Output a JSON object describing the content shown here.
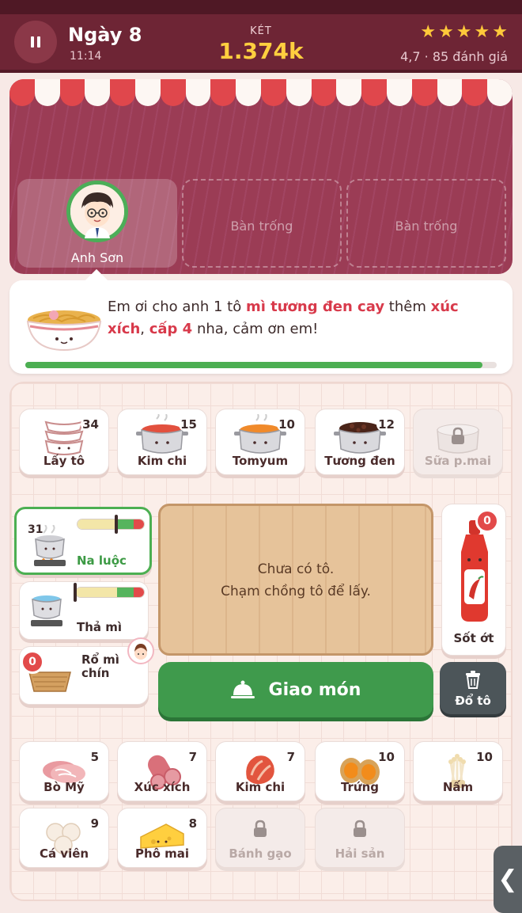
{
  "header": {
    "day": "Ngày 8",
    "time": "11:14",
    "till_label": "KÉT",
    "till_value": "1.374k",
    "stars": 5,
    "rating": "4,7 · 85 đánh giá"
  },
  "store": {
    "customer_name": "Anh Sơn",
    "empty_table_1": "Bàn trống",
    "empty_table_2": "Bàn trống"
  },
  "order": {
    "part1": "Em ơi cho anh 1 tô ",
    "dish": "mì tương đen cay",
    "part2": " thêm ",
    "topping": "xúc xích",
    "part3": ", ",
    "level": "cấp 4",
    "part4": " nha, cảm ơn em!",
    "patience": 0.97
  },
  "bases": [
    {
      "label": "Lấy tô",
      "count": "34",
      "icon": "bowls-icon"
    },
    {
      "label": "Kim chi",
      "count": "15",
      "icon": "kimchi-pot-icon"
    },
    {
      "label": "Tomyum",
      "count": "10",
      "icon": "tomyum-pot-icon"
    },
    {
      "label": "Tương đen",
      "count": "12",
      "icon": "black-bean-pot-icon"
    },
    {
      "label": "Sữa p.mai",
      "count": "",
      "icon": "lock-icon"
    }
  ],
  "cookers": {
    "boil": {
      "label": "Na luộc",
      "count": "31"
    },
    "noodle": {
      "label": "Thả mì"
    },
    "strainer": {
      "label": "Rổ mì chín",
      "count": "0"
    }
  },
  "board": {
    "line1": "Chưa có tô.",
    "line2": "Chạm chồng tô để lấy."
  },
  "sauce": {
    "label": "Sốt ớt",
    "count": "0"
  },
  "actions": {
    "deliver": "Giao món",
    "trash": "Đổ tô",
    "side_tab": "❮"
  },
  "toppings": [
    {
      "label": "Bò Mỹ",
      "count": "5"
    },
    {
      "label": "Xúc xích",
      "count": "7"
    },
    {
      "label": "Kim chi",
      "count": "7"
    },
    {
      "label": "Trứng",
      "count": "10"
    },
    {
      "label": "Nấm",
      "count": "10"
    },
    {
      "label": "Cá viên",
      "count": "9"
    },
    {
      "label": "Phô mai",
      "count": "8"
    },
    {
      "label": "Bánh gạo",
      "count": ""
    },
    {
      "label": "Hải sản",
      "count": ""
    }
  ],
  "colors": {
    "header": "#6e2535",
    "accent_gold": "#ffcf3f",
    "green": "#4caf52",
    "red": "#e24a4a"
  }
}
